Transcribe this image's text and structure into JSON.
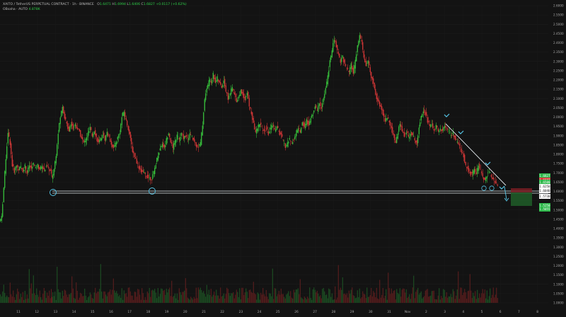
{
  "symbol_line": {
    "symbol": "XAITO / TetherUS PERPETUAL CONTRACT · 1h · BINANCE",
    "open_label": "O",
    "open": "1.6471",
    "high_label": "H",
    "high": "1.6994",
    "low_label": "L",
    "low": "1.6406",
    "close_label": "C",
    "close": "1.6827",
    "change": "+0.0117 (+0.62%)"
  },
  "indicator_line": {
    "name": "OBsaha · AUTO",
    "value": "4.878K"
  },
  "colors": {
    "background": "#131313",
    "up": "#3bd03f",
    "down": "#e63a3a",
    "annotation": "#56c7e8",
    "box_green": "#1f5a28",
    "box_red": "#7a1f25"
  },
  "price_badges": [
    {
      "label": "1.6827",
      "price": 1.6827,
      "color": "#2db84a"
    },
    {
      "label": "1.6607",
      "price": 1.6607,
      "color": "#d63a3a"
    },
    {
      "label": "1.6500",
      "price": 1.65,
      "color": "#2db84a"
    },
    {
      "label": "1.6250",
      "price": 1.625,
      "color": "#ffffff"
    },
    {
      "label": "1.6040",
      "price": 1.604,
      "color": "#ffffff"
    },
    {
      "label": "1.5730",
      "price": 1.573,
      "color": "#ffffff"
    },
    {
      "label": "1.5250",
      "price": 1.525,
      "color": "#2db84a"
    },
    {
      "label": "1.5055",
      "price": 1.5055,
      "color": "#2db84a"
    }
  ],
  "chart_data": {
    "type": "candlestick",
    "y_axis_ticks": [
      "2.6000",
      "2.5500",
      "2.5000",
      "2.4500",
      "2.4000",
      "2.3500",
      "2.3000",
      "2.2500",
      "2.2000",
      "2.1500",
      "2.1000",
      "2.0500",
      "2.0000",
      "1.9500",
      "1.9000",
      "1.8500",
      "1.8000",
      "1.7500",
      "1.7000",
      "1.6500",
      "1.6000",
      "1.5500",
      "1.5000",
      "1.4500",
      "1.4000",
      "1.3500",
      "1.3000",
      "1.2500",
      "1.2000",
      "1.1500",
      "1.1000",
      "1.0500",
      "1.0000"
    ],
    "x_axis_ticks": [
      "11",
      "12",
      "13",
      "14",
      "15",
      "16",
      "17",
      "18",
      "19",
      "20",
      "21",
      "22",
      "23",
      "24",
      "25",
      "26",
      "27",
      "28",
      "29",
      "30",
      "31",
      "Nov",
      "2",
      "3",
      "4",
      "5",
      "6",
      "7",
      "8"
    ],
    "ylim": [
      1.0,
      2.6
    ],
    "price_path": [
      [
        0,
        1.44
      ],
      [
        3,
        1.46
      ],
      [
        6,
        1.62
      ],
      [
        9,
        1.78
      ],
      [
        12,
        1.92
      ],
      [
        15,
        1.86
      ],
      [
        18,
        1.74
      ],
      [
        21,
        1.71
      ],
      [
        24,
        1.74
      ],
      [
        27,
        1.72
      ],
      [
        30,
        1.73
      ],
      [
        33,
        1.71
      ],
      [
        36,
        1.74
      ],
      [
        39,
        1.7
      ],
      [
        42,
        1.74
      ],
      [
        45,
        1.72
      ],
      [
        48,
        1.75
      ],
      [
        51,
        1.72
      ],
      [
        54,
        1.74
      ],
      [
        57,
        1.72
      ],
      [
        60,
        1.74
      ],
      [
        63,
        1.71
      ],
      [
        66,
        1.74
      ],
      [
        69,
        1.72
      ],
      [
        72,
        1.71
      ],
      [
        74,
        1.67
      ],
      [
        77,
        1.72
      ],
      [
        80,
        1.8
      ],
      [
        83,
        1.92
      ],
      [
        86,
        2.0
      ],
      [
        89,
        2.06
      ],
      [
        92,
        2.0
      ],
      [
        95,
        1.96
      ],
      [
        98,
        1.93
      ],
      [
        101,
        1.97
      ],
      [
        104,
        1.94
      ],
      [
        107,
        1.96
      ],
      [
        110,
        1.94
      ],
      [
        113,
        1.92
      ],
      [
        116,
        1.89
      ],
      [
        119,
        1.86
      ],
      [
        122,
        1.88
      ],
      [
        125,
        1.91
      ],
      [
        128,
        1.94
      ],
      [
        131,
        1.9
      ],
      [
        134,
        1.93
      ],
      [
        137,
        1.89
      ],
      [
        140,
        1.86
      ],
      [
        143,
        1.88
      ],
      [
        146,
        1.91
      ],
      [
        149,
        1.88
      ],
      [
        152,
        1.92
      ],
      [
        155,
        1.89
      ],
      [
        158,
        1.86
      ],
      [
        161,
        1.83
      ],
      [
        164,
        1.86
      ],
      [
        167,
        1.89
      ],
      [
        170,
        1.92
      ],
      [
        173,
        2.0
      ],
      [
        176,
        2.03
      ],
      [
        179,
        1.98
      ],
      [
        182,
        1.94
      ],
      [
        185,
        1.88
      ],
      [
        188,
        1.82
      ],
      [
        191,
        1.79
      ],
      [
        194,
        1.76
      ],
      [
        197,
        1.73
      ],
      [
        200,
        1.71
      ],
      [
        203,
        1.7
      ],
      [
        206,
        1.69
      ],
      [
        209,
        1.68
      ],
      [
        212,
        1.67
      ],
      [
        215,
        1.67
      ],
      [
        218,
        1.7
      ],
      [
        221,
        1.75
      ],
      [
        224,
        1.8
      ],
      [
        227,
        1.83
      ],
      [
        230,
        1.86
      ],
      [
        233,
        1.83
      ],
      [
        236,
        1.88
      ],
      [
        239,
        1.92
      ],
      [
        242,
        1.87
      ],
      [
        245,
        1.83
      ],
      [
        248,
        1.87
      ],
      [
        251,
        1.9
      ],
      [
        254,
        1.88
      ],
      [
        257,
        1.91
      ],
      [
        260,
        1.89
      ],
      [
        263,
        1.9
      ],
      [
        266,
        1.88
      ],
      [
        269,
        1.91
      ],
      [
        272,
        1.89
      ],
      [
        275,
        1.87
      ],
      [
        278,
        1.85
      ],
      [
        281,
        1.84
      ],
      [
        284,
        1.86
      ],
      [
        287,
        1.96
      ],
      [
        290,
        2.1
      ],
      [
        293,
        2.15
      ],
      [
        296,
        2.2
      ],
      [
        299,
        2.19
      ],
      [
        302,
        2.23
      ],
      [
        305,
        2.19
      ],
      [
        308,
        2.21
      ],
      [
        311,
        2.18
      ],
      [
        314,
        2.16
      ],
      [
        317,
        2.2
      ],
      [
        320,
        2.14
      ],
      [
        323,
        2.1
      ],
      [
        326,
        2.13
      ],
      [
        329,
        2.16
      ],
      [
        332,
        2.12
      ],
      [
        335,
        2.09
      ],
      [
        338,
        2.11
      ],
      [
        341,
        2.14
      ],
      [
        344,
        2.12
      ],
      [
        347,
        2.1
      ],
      [
        350,
        2.13
      ],
      [
        353,
        2.06
      ],
      [
        356,
        2.02
      ],
      [
        359,
        1.96
      ],
      [
        362,
        1.92
      ],
      [
        365,
        1.94
      ],
      [
        368,
        1.97
      ],
      [
        371,
        1.94
      ],
      [
        374,
        1.92
      ],
      [
        377,
        1.94
      ],
      [
        380,
        1.91
      ],
      [
        383,
        1.94
      ],
      [
        386,
        1.96
      ],
      [
        389,
        1.93
      ],
      [
        392,
        1.95
      ],
      [
        395,
        1.92
      ],
      [
        398,
        1.9
      ],
      [
        401,
        1.87
      ],
      [
        404,
        1.84
      ],
      [
        407,
        1.86
      ],
      [
        410,
        1.88
      ],
      [
        413,
        1.86
      ],
      [
        416,
        1.88
      ],
      [
        419,
        1.91
      ],
      [
        422,
        1.94
      ],
      [
        425,
        1.92
      ],
      [
        428,
        1.97
      ],
      [
        431,
        1.95
      ],
      [
        434,
        1.98
      ],
      [
        437,
        1.96
      ],
      [
        440,
        1.99
      ],
      [
        443,
        2.02
      ],
      [
        446,
        2.06
      ],
      [
        449,
        2.03
      ],
      [
        452,
        2.08
      ],
      [
        455,
        2.05
      ],
      [
        458,
        2.1
      ],
      [
        461,
        2.15
      ],
      [
        464,
        2.22
      ],
      [
        467,
        2.3
      ],
      [
        470,
        2.36
      ],
      [
        473,
        2.42
      ],
      [
        476,
        2.38
      ],
      [
        479,
        2.34
      ],
      [
        482,
        2.3
      ],
      [
        485,
        2.33
      ],
      [
        488,
        2.28
      ],
      [
        491,
        2.26
      ],
      [
        494,
        2.24
      ],
      [
        497,
        2.28
      ],
      [
        500,
        2.24
      ],
      [
        503,
        2.3
      ],
      [
        506,
        2.38
      ],
      [
        509,
        2.44
      ],
      [
        512,
        2.4
      ],
      [
        515,
        2.32
      ],
      [
        518,
        2.28
      ],
      [
        521,
        2.3
      ],
      [
        524,
        2.24
      ],
      [
        527,
        2.2
      ],
      [
        530,
        2.16
      ],
      [
        533,
        2.1
      ],
      [
        536,
        2.08
      ],
      [
        539,
        2.05
      ],
      [
        542,
        2.02
      ],
      [
        545,
        1.98
      ],
      [
        548,
        2.0
      ],
      [
        551,
        1.97
      ],
      [
        554,
        1.94
      ],
      [
        557,
        1.9
      ],
      [
        560,
        1.86
      ],
      [
        563,
        1.92
      ],
      [
        566,
        1.96
      ],
      [
        569,
        1.93
      ],
      [
        572,
        1.9
      ],
      [
        575,
        1.92
      ],
      [
        578,
        1.89
      ],
      [
        581,
        1.92
      ],
      [
        584,
        1.9
      ],
      [
        587,
        1.88
      ],
      [
        590,
        1.86
      ],
      [
        593,
        1.95
      ],
      [
        596,
        2.01
      ],
      [
        599,
        2.04
      ],
      [
        602,
        2.02
      ],
      [
        605,
        1.98
      ],
      [
        608,
        1.95
      ],
      [
        611,
        1.96
      ],
      [
        614,
        1.93
      ],
      [
        617,
        1.95
      ],
      [
        620,
        1.92
      ],
      [
        623,
        1.94
      ],
      [
        626,
        1.92
      ],
      [
        629,
        1.96
      ],
      [
        632,
        1.93
      ],
      [
        635,
        1.92
      ],
      [
        638,
        1.9
      ],
      [
        641,
        1.91
      ],
      [
        644,
        1.88
      ],
      [
        647,
        1.86
      ],
      [
        650,
        1.84
      ],
      [
        653,
        1.81
      ],
      [
        656,
        1.79
      ],
      [
        659,
        1.74
      ],
      [
        662,
        1.72
      ],
      [
        665,
        1.7
      ],
      [
        668,
        1.69
      ],
      [
        671,
        1.72
      ],
      [
        674,
        1.7
      ],
      [
        677,
        1.74
      ],
      [
        680,
        1.71
      ],
      [
        683,
        1.68
      ],
      [
        686,
        1.66
      ],
      [
        689,
        1.69
      ],
      [
        692,
        1.71
      ],
      [
        695,
        1.68
      ],
      [
        698,
        1.66
      ],
      [
        701,
        1.65
      ],
      [
        704,
        1.64
      ]
    ]
  }
}
